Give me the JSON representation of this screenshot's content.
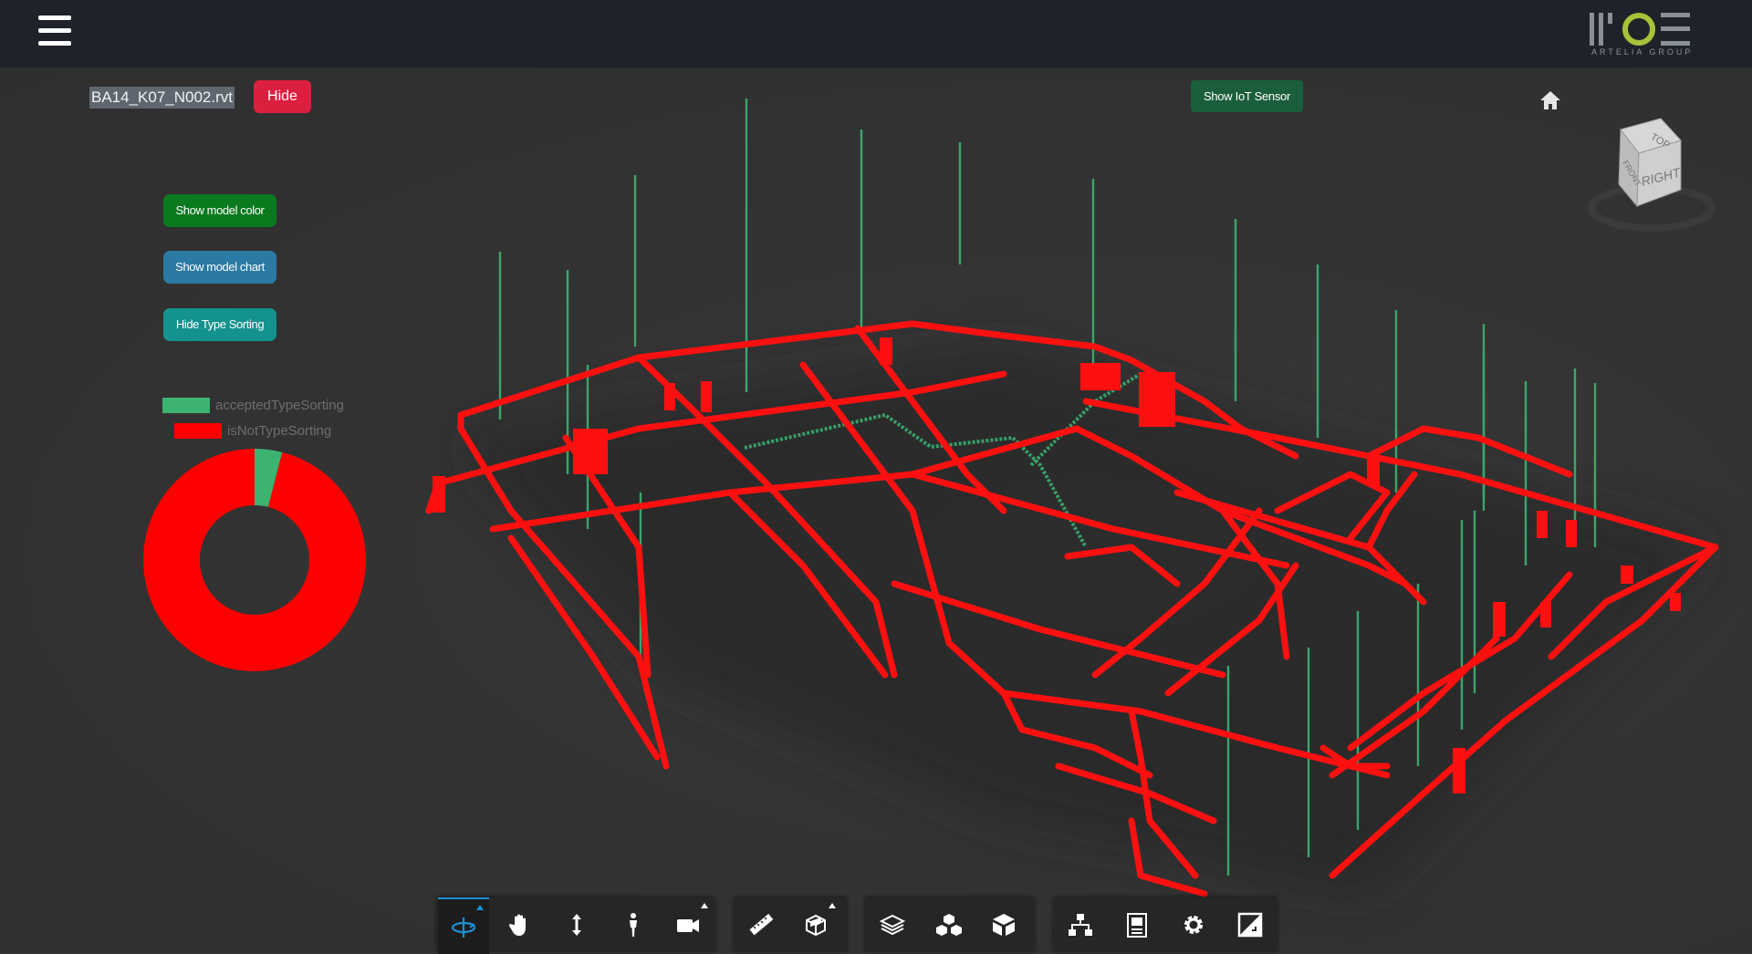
{
  "header": {
    "menu_icon": "hamburger-menu-icon",
    "logo_text": "MOE",
    "logo_subtext": "ARTELIA GROUP"
  },
  "model": {
    "file_name": "BA14_K07_N002.rvt",
    "hide_label": "Hide"
  },
  "iot": {
    "show_label": "Show IoT Sensor"
  },
  "side_panel": {
    "show_color_label": "Show model color",
    "show_chart_label": "Show model chart",
    "hide_sorting_label": "Hide Type Sorting"
  },
  "colors": {
    "accepted": "#3cb371",
    "not_accepted": "#ff0000",
    "hide_button": "#dc1f3f",
    "iot_button": "#1b5e3b",
    "color_button": "#0b7a1f",
    "chart_button": "#2a7aa3",
    "sorting_button": "#14928f",
    "toolbar_accent": "#1a8fd5"
  },
  "chart_data": {
    "type": "pie",
    "labels": [
      "acceptedTypeSorting",
      "isNotTypeSorting"
    ],
    "values": [
      4,
      96
    ],
    "colors": [
      "#3cb371",
      "#ff0000"
    ],
    "donut": true,
    "legend_placement": "top"
  },
  "viewcube": {
    "top_label": "TOP",
    "front_label": "FRONT",
    "right_label": "RIGHT"
  },
  "toolbar": {
    "tools": [
      "orbit-icon",
      "pan-icon",
      "zoom-icon",
      "first-person-icon",
      "camera-icon",
      "measure-icon",
      "section-icon",
      "model-browser-icon",
      "explode-icon",
      "properties-cube-icon",
      "structure-icon",
      "document-browser-icon",
      "settings-icon",
      "fullscreen-icon"
    ]
  }
}
